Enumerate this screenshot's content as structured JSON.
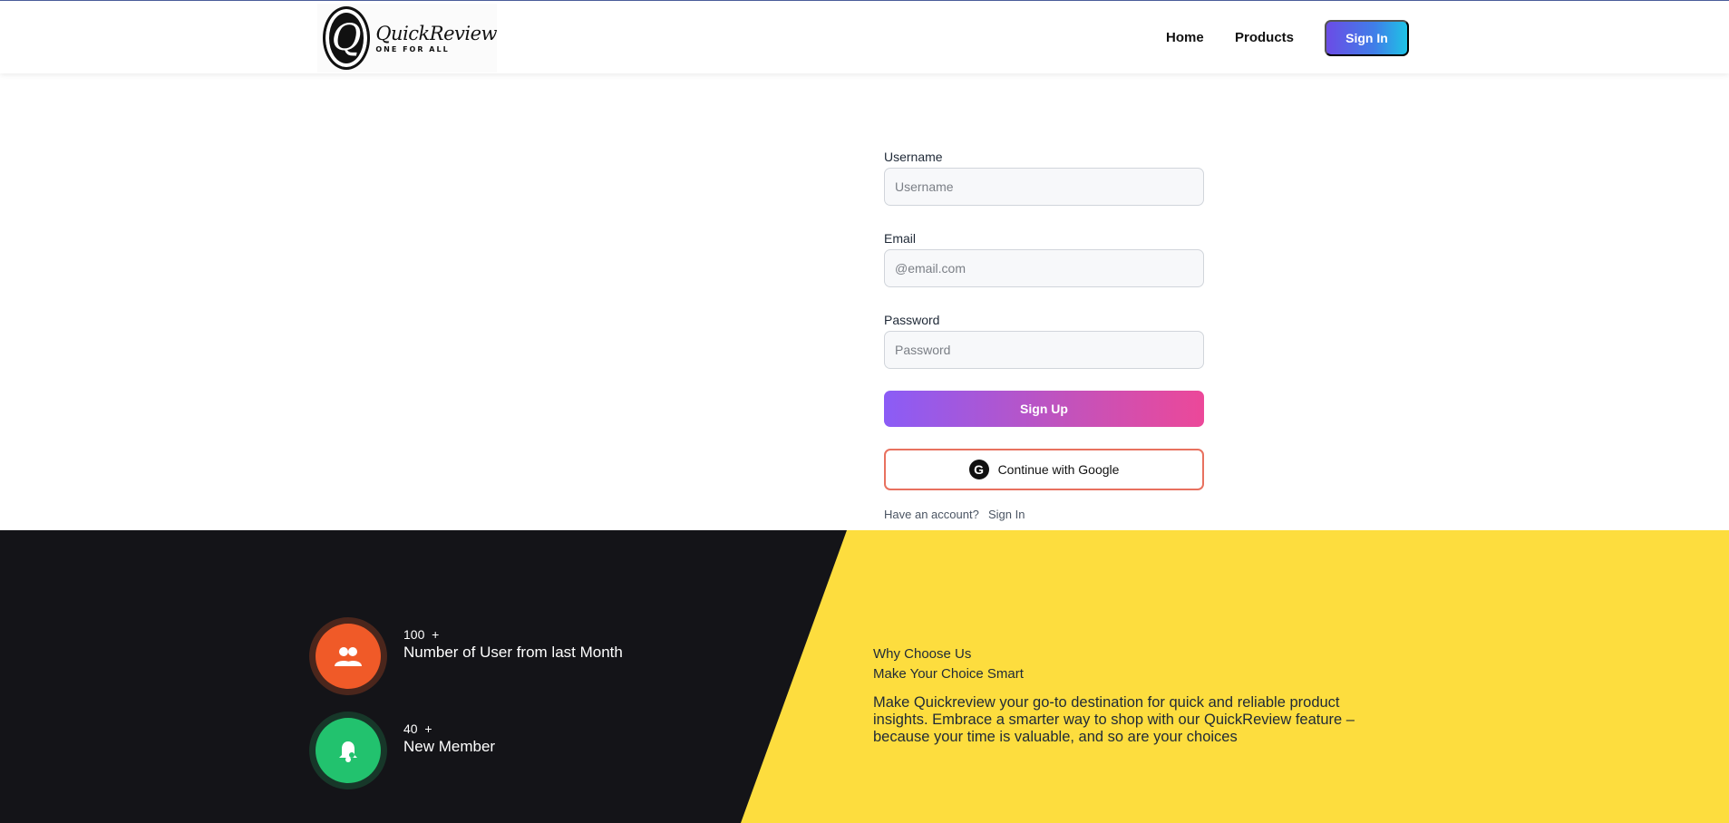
{
  "brand": {
    "logo_letter": "Q",
    "name": "QuickReview",
    "tagline": "ONE FOR ALL"
  },
  "nav": {
    "home": "Home",
    "products": "Products",
    "sign_in": "Sign In"
  },
  "form": {
    "username_label": "Username",
    "username_placeholder": "Username",
    "email_label": "Email",
    "email_placeholder": "@email.com",
    "password_label": "Password",
    "password_placeholder": "Password",
    "signup_button": "Sign Up",
    "google_button": "Continue with Google",
    "google_icon_letter": "G",
    "have_account": "Have an account?",
    "sign_in_link": "Sign In"
  },
  "stats": [
    {
      "number": "100",
      "plus": "+",
      "label": "Number of User from last Month",
      "icon": "users-icon",
      "color": "#f05a28"
    },
    {
      "number": "40",
      "plus": "+",
      "label": "New Member",
      "icon": "bell-icon",
      "color": "#22c26e"
    }
  ],
  "why": {
    "title": "Why Choose Us",
    "subtitle": "Make Your Choice Smart",
    "body": "Make Quickreview your go-to destination for quick and reliable product insights. Embrace a smarter way to shop with our QuickReview feature – because your time is valuable, and so are your choices"
  },
  "colors": {
    "accent_yellow": "#fddd3e",
    "dark_bg": "#141418",
    "signup_gradient_start": "#8b5cf6",
    "signup_gradient_end": "#ec4899"
  }
}
